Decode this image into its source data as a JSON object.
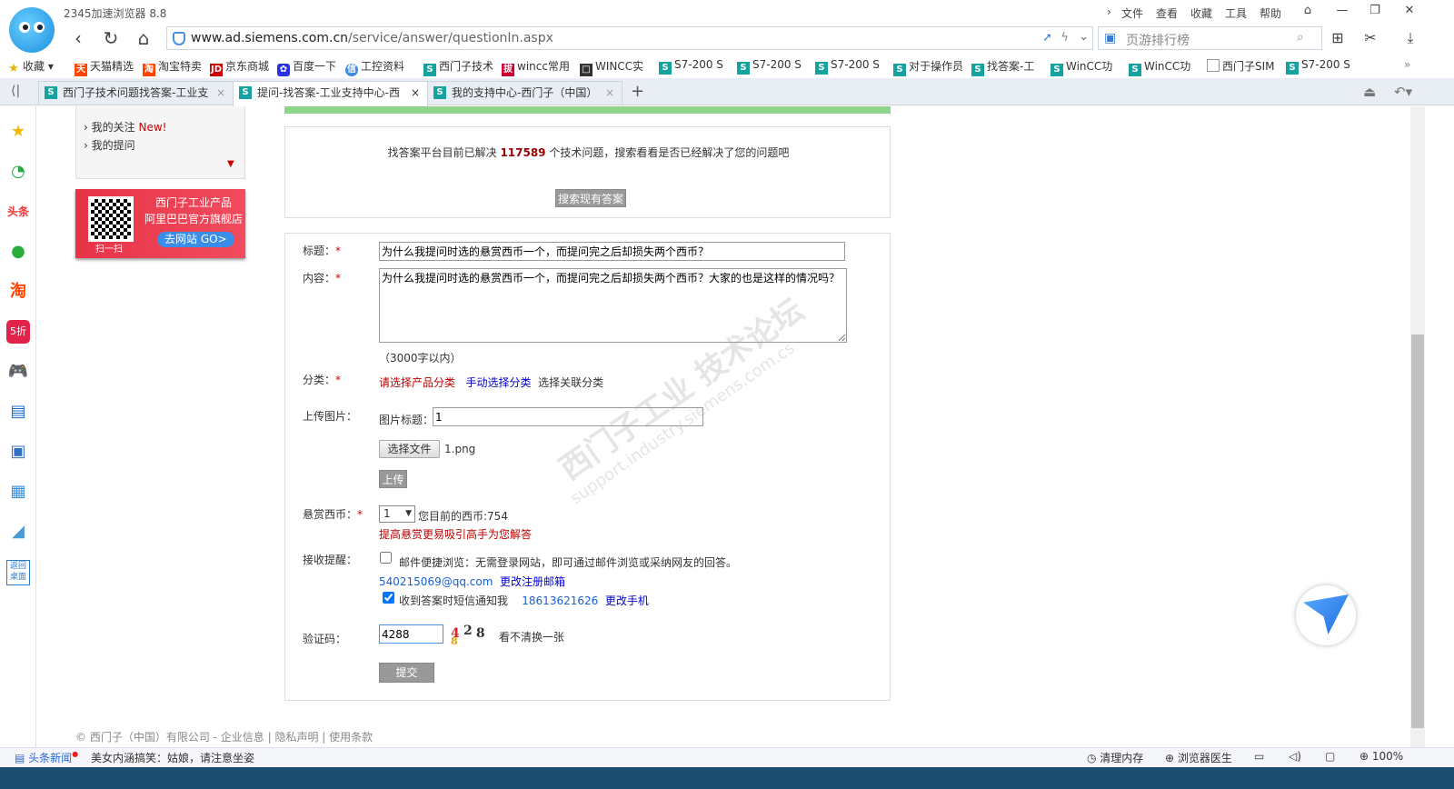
{
  "app": {
    "title": "2345加速浏览器 8.8"
  },
  "menu": {
    "items": [
      "文件",
      "查看",
      "收藏",
      "工具",
      "帮助"
    ]
  },
  "nav": {
    "url_domain": "www.ad.siemens.com.cn",
    "url_path": "/service/answer/questionIn.aspx",
    "search_placeholder": "页游排行榜"
  },
  "bookmarks": [
    {
      "label": "收藏",
      "icon": "star-icon"
    },
    {
      "label": "天猫精选",
      "icon": "tmall-icon"
    },
    {
      "label": "淘宝特卖",
      "icon": "taobao-icon"
    },
    {
      "label": "京东商城",
      "icon": "jd-icon"
    },
    {
      "label": "百度一下",
      "icon": "baidu-icon"
    },
    {
      "label": "工控资料",
      "icon": "gongkong-icon"
    },
    {
      "label": "西门子技术",
      "icon": "siemens-icon"
    },
    {
      "label": "wincc常用",
      "icon": "wincc-icon"
    },
    {
      "label": "WINCC实",
      "icon": "wincc-icon"
    },
    {
      "label": "S7-200 S",
      "icon": "siemens-icon"
    },
    {
      "label": "S7-200 S",
      "icon": "siemens-icon"
    },
    {
      "label": "S7-200 S",
      "icon": "siemens-icon"
    },
    {
      "label": "对于操作员",
      "icon": "siemens-icon"
    },
    {
      "label": "找答案-工",
      "icon": "siemens-icon"
    },
    {
      "label": "WinCC功",
      "icon": "siemens-icon"
    },
    {
      "label": "WinCC功",
      "icon": "siemens-icon"
    },
    {
      "label": "西门子SIM",
      "icon": "doc-icon"
    },
    {
      "label": "S7-200 S",
      "icon": "siemens-icon"
    }
  ],
  "tabs": [
    {
      "label": "西门子技术问题找答案-工业支"
    },
    {
      "label": "提问-找答案-工业支持中心-西"
    },
    {
      "label": "我的支持中心-西门子（中国）"
    }
  ],
  "left": {
    "follow": "我的关注",
    "new_badge": "New!",
    "questions": "我的提问"
  },
  "ad": {
    "line1": "西门子工业产品",
    "line2": "阿里巴巴官方旗舰店",
    "scan": "扫一扫",
    "go": "去网站 GO>"
  },
  "search_section": {
    "text_prefix": "找答案平台目前已解决 ",
    "count": "117589",
    "text_suffix": " 个技术问题，搜索看看是否已经解决了您的问题吧",
    "button": "搜索现有答案"
  },
  "form": {
    "title_label": "标题：",
    "title_value": "为什么我提问时选的悬赏西币一个，而提问完之后却损失两个西币？",
    "content_label": "内容：",
    "content_value": "为什么我提问时选的悬赏西币一个，而提问完之后却损失两个西币？大家的也是这样的情况吗？",
    "content_limit": "（3000字以内）",
    "category_label": "分类：",
    "category_product": "请选择产品分类",
    "category_manual": "手动选择分类",
    "category_related": "选择关联分类",
    "upload_label": "上传图片：",
    "image_title_label": "图片标题：",
    "image_title_value": "1",
    "choose_file": "选择文件",
    "file_name": "1.png",
    "upload_button": "上传",
    "reward_label": "悬赏西币：",
    "reward_value": "1",
    "coins_text": "您目前的西币:754",
    "reward_hint": "提高悬赏更易吸引高手为您解答",
    "notify_label": "接收提醒：",
    "email_option": "邮件便捷浏览：无需登录网站，即可通过邮件浏览或采纳网友的回答。",
    "email": "540215069@qq.com",
    "change_email": "更改注册邮箱",
    "sms_option": "收到答案时短信通知我",
    "phone": "18613621626",
    "change_phone": "更改手机",
    "captcha_label": "验证码：",
    "captcha_value": "4288",
    "captcha_chars": [
      "4",
      "2",
      "8",
      "8"
    ],
    "captcha_refresh": "看不清换一张",
    "submit": "提交"
  },
  "watermark": {
    "line1": "西门子工业 技术论坛",
    "line2": "support.industry.siemens.com.cs"
  },
  "footer": {
    "text": "© 西门子（中国）有限公司 - 企业信息 | 隐私声明 | 使用条款"
  },
  "status": {
    "news": "头条新闻",
    "headline": "美女内涵搞笑：姑娘，请注意坐姿",
    "clean": "清理内存",
    "doctor": "浏览器医生",
    "zoom": "100%"
  }
}
